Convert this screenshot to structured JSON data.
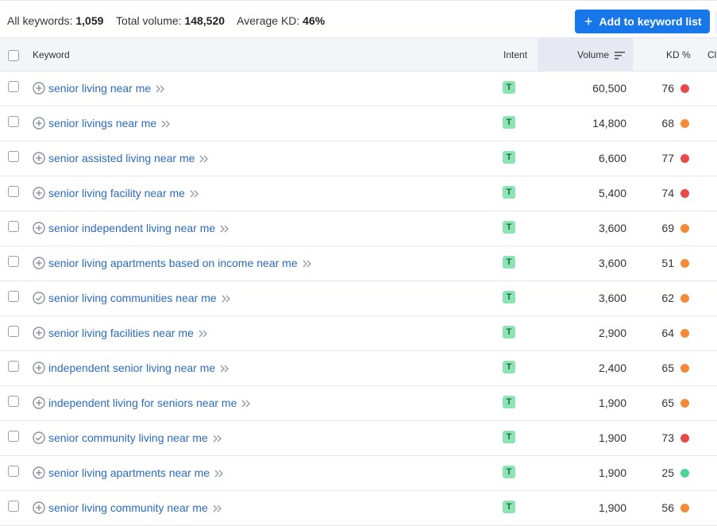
{
  "summary": {
    "all_keywords_label": "All keywords:",
    "all_keywords_value": "1,059",
    "total_volume_label": "Total volume:",
    "total_volume_value": "148,520",
    "avg_kd_label": "Average KD:",
    "avg_kd_value": "46%"
  },
  "add_button": {
    "icon": "+",
    "label": "Add to keyword list"
  },
  "columns": {
    "keyword": "Keyword",
    "intent": "Intent",
    "volume": "Volume",
    "kd": "KD %",
    "next": "Cl"
  },
  "colors": {
    "red": "#e84a4a",
    "orange": "#f5893a",
    "green": "#4dd49a",
    "link": "#2c6bbf",
    "accent": "#1777e8"
  },
  "rows": [
    {
      "keyword": "senior living near me",
      "icon": "plus-circle-icon",
      "intent": "T",
      "volume": "60,500",
      "kd": "76",
      "kd_color": "red"
    },
    {
      "keyword": "senior livings near me",
      "icon": "plus-circle-icon",
      "intent": "T",
      "volume": "14,800",
      "kd": "68",
      "kd_color": "orange"
    },
    {
      "keyword": "senior assisted living near me",
      "icon": "plus-circle-icon",
      "intent": "T",
      "volume": "6,600",
      "kd": "77",
      "kd_color": "red"
    },
    {
      "keyword": "senior living facility near me",
      "icon": "plus-circle-icon",
      "intent": "T",
      "volume": "5,400",
      "kd": "74",
      "kd_color": "red"
    },
    {
      "keyword": "senior independent living near me",
      "icon": "plus-circle-icon",
      "intent": "T",
      "volume": "3,600",
      "kd": "69",
      "kd_color": "orange"
    },
    {
      "keyword": "senior living apartments based on income near me",
      "icon": "plus-circle-icon",
      "intent": "T",
      "volume": "3,600",
      "kd": "51",
      "kd_color": "orange"
    },
    {
      "keyword": "senior living communities near me",
      "icon": "check-circle-icon",
      "intent": "T",
      "volume": "3,600",
      "kd": "62",
      "kd_color": "orange"
    },
    {
      "keyword": "senior living facilities near me",
      "icon": "plus-circle-icon",
      "intent": "T",
      "volume": "2,900",
      "kd": "64",
      "kd_color": "orange"
    },
    {
      "keyword": "independent senior living near me",
      "icon": "plus-circle-icon",
      "intent": "T",
      "volume": "2,400",
      "kd": "65",
      "kd_color": "orange"
    },
    {
      "keyword": "independent living for seniors near me",
      "icon": "plus-circle-icon",
      "intent": "T",
      "volume": "1,900",
      "kd": "65",
      "kd_color": "orange"
    },
    {
      "keyword": "senior community living near me",
      "icon": "check-circle-icon",
      "intent": "T",
      "volume": "1,900",
      "kd": "73",
      "kd_color": "red"
    },
    {
      "keyword": "senior living apartments near me",
      "icon": "plus-circle-icon",
      "intent": "T",
      "volume": "1,900",
      "kd": "25",
      "kd_color": "green"
    },
    {
      "keyword": "senior living community near me",
      "icon": "plus-circle-icon",
      "intent": "T",
      "volume": "1,900",
      "kd": "56",
      "kd_color": "orange"
    }
  ]
}
